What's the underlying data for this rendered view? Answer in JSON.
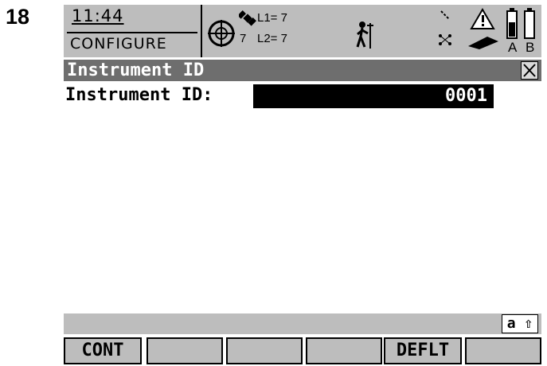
{
  "figure": {
    "number": "18"
  },
  "status": {
    "time": "11:44",
    "mode": "CONFIGURE",
    "gps": {
      "l1": "L1= 7",
      "l2": "L2= 7",
      "sat_count": "7"
    },
    "battery": {
      "a_label": "A",
      "b_label": "B"
    },
    "icons": [
      "crosshair-icon",
      "satellite-icon",
      "surveyor-icon",
      "link-icon",
      "warning-icon",
      "memory-card-icon",
      "battery-icon"
    ]
  },
  "dialog": {
    "title": "Instrument ID",
    "field_label": "Instrument ID:",
    "field_value": "0001"
  },
  "input_mode": "a ⇧",
  "fkeys": [
    "CONT",
    "",
    "",
    "",
    "DEFLT",
    ""
  ]
}
